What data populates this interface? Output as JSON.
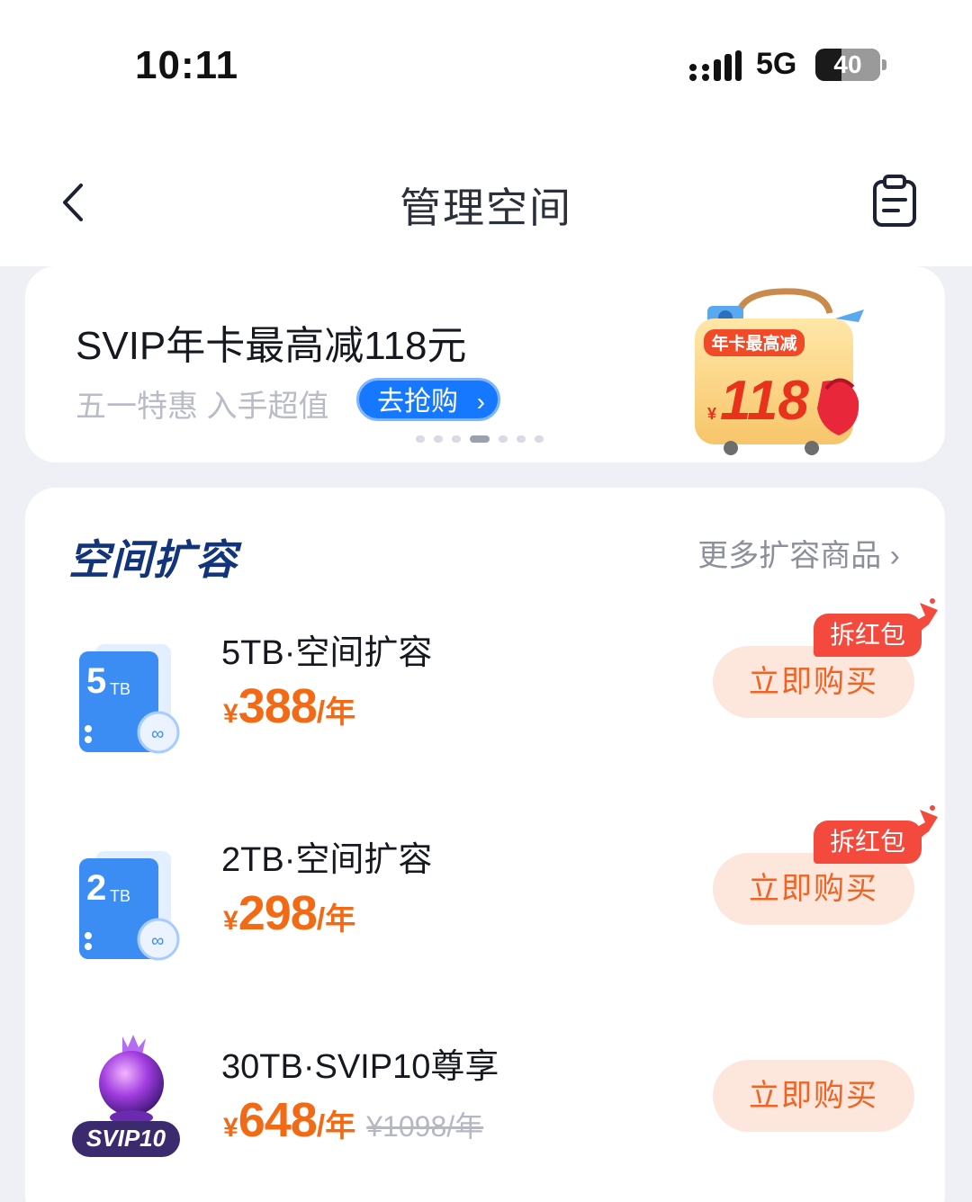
{
  "status_bar": {
    "time": "10:11",
    "network": "5G",
    "battery": "40",
    "battery_level": 0.4
  },
  "header": {
    "title": "管理空间",
    "back_icon": "chevron-left-icon",
    "right_icon": "clipboard-icon"
  },
  "banner": {
    "title": "SVIP年卡最高减118元",
    "subtitle": "五一特惠 入手超值",
    "cta": "去抢购",
    "art": {
      "badge": "年卡最高减",
      "currency": "¥",
      "amount": "118"
    },
    "pager": {
      "count": 7,
      "active": 3
    }
  },
  "expansion": {
    "title": "空间扩容",
    "more_label": "更多扩容商品",
    "products": [
      {
        "name": "5TB·空间扩容",
        "currency": "¥",
        "price": "388",
        "unit": "/年",
        "original": "",
        "tag": "拆红包",
        "buy": "立即购买",
        "icon_label": "5",
        "icon_unit": "TB"
      },
      {
        "name": "2TB·空间扩容",
        "currency": "¥",
        "price": "298",
        "unit": "/年",
        "original": "",
        "tag": "拆红包",
        "buy": "立即购买",
        "icon_label": "2",
        "icon_unit": "TB"
      },
      {
        "name": "30TB·SVIP10尊享",
        "currency": "¥",
        "price": "648",
        "unit": "/年",
        "original": "¥1098/年",
        "tag": "",
        "buy": "立即购买",
        "icon_label": "SVIP10",
        "icon_unit": ""
      }
    ]
  },
  "colors": {
    "accent_blue": "#1677ff",
    "price_orange": "#f36a16",
    "tag_red": "#f44a3d",
    "title_navy": "#12347a"
  }
}
